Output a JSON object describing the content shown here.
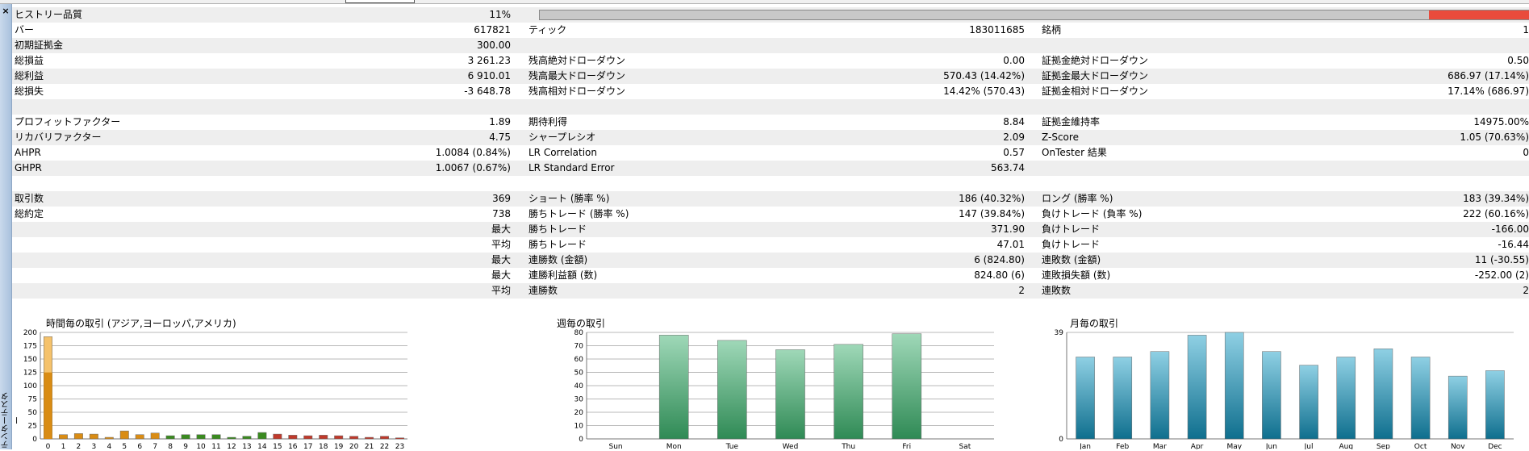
{
  "panel": {
    "close_glyph": "×",
    "vertical_title": "テンターテスター"
  },
  "quality": {
    "label": "ヒストリー品質",
    "value": "11%",
    "fraction": 0.11
  },
  "rows": [
    {
      "alt": true,
      "l1": "ヒストリー品質",
      "v1": "11%",
      "l2": "",
      "v2": "",
      "l3": "",
      "v3": "",
      "bar": true
    },
    {
      "alt": false,
      "l1": "バー",
      "v1": "617821",
      "l2": "ティック",
      "v2": "183011685",
      "l3": "銘柄",
      "v3": "1"
    },
    {
      "alt": true,
      "l1": "初期証拠金",
      "v1": "300.00",
      "l2": "",
      "v2": "",
      "l3": "",
      "v3": ""
    },
    {
      "alt": false,
      "l1": "総損益",
      "v1": "3 261.23",
      "l2": "残高絶対ドローダウン",
      "v2": "0.00",
      "l3": "証拠金絶対ドローダウン",
      "v3": "0.50"
    },
    {
      "alt": true,
      "l1": "総利益",
      "v1": "6 910.01",
      "l2": "残高最大ドローダウン",
      "v2": "570.43 (14.42%)",
      "l3": "証拠金最大ドローダウン",
      "v3": "686.97 (17.14%)"
    },
    {
      "alt": false,
      "l1": "総損失",
      "v1": "-3 648.78",
      "l2": "残高相対ドローダウン",
      "v2": "14.42% (570.43)",
      "l3": "証拠金相対ドローダウン",
      "v3": "17.14% (686.97)"
    },
    {
      "alt": true,
      "l1": "",
      "v1": "",
      "l2": "",
      "v2": "",
      "l3": "",
      "v3": ""
    },
    {
      "alt": false,
      "l1": "プロフィットファクター",
      "v1": "1.89",
      "l2": "期待利得",
      "v2": "8.84",
      "l3": "証拠金維持率",
      "v3": "14975.00%"
    },
    {
      "alt": true,
      "l1": "リカバリファクター",
      "v1": "4.75",
      "l2": "シャープレシオ",
      "v2": "2.09",
      "l3": "Z-Score",
      "v3": "1.05 (70.63%)"
    },
    {
      "alt": false,
      "l1": "AHPR",
      "v1": "1.0084 (0.84%)",
      "l2": "LR Correlation",
      "v2": "0.57",
      "l3": "OnTester 結果",
      "v3": "0"
    },
    {
      "alt": true,
      "l1": "GHPR",
      "v1": "1.0067 (0.67%)",
      "l2": "LR Standard Error",
      "v2": "563.74",
      "l3": "",
      "v3": ""
    },
    {
      "alt": false,
      "l1": "",
      "v1": "",
      "l2": "",
      "v2": "",
      "l3": "",
      "v3": ""
    },
    {
      "alt": true,
      "l1": "取引数",
      "v1": "369",
      "l2": "ショート (勝率 %)",
      "v2": "186 (40.32%)",
      "l3": "ロング (勝率 %)",
      "v3": "183 (39.34%)"
    },
    {
      "alt": false,
      "l1": "総約定",
      "v1": "738",
      "l2": "勝ちトレード (勝率 %)",
      "v2": "147 (39.84%)",
      "l3": "負けトレード (負率 %)",
      "v3": "222 (60.16%)"
    },
    {
      "alt": true,
      "l1": "",
      "v1": "最大",
      "l2": "勝ちトレード",
      "v2": "371.90",
      "l3": "負けトレード",
      "v3": "-166.00"
    },
    {
      "alt": false,
      "l1": "",
      "v1": "平均",
      "l2": "勝ちトレード",
      "v2": "47.01",
      "l3": "負けトレード",
      "v3": "-16.44"
    },
    {
      "alt": true,
      "l1": "",
      "v1": "最大",
      "l2": "連勝数 (金額)",
      "v2": "6 (824.80)",
      "l3": "連敗数 (金額)",
      "v3": "11 (-30.55)"
    },
    {
      "alt": false,
      "l1": "",
      "v1": "最大",
      "l2": "連勝利益額 (数)",
      "v2": "824.80 (6)",
      "l3": "連敗損失額 (数)",
      "v3": "-252.00 (2)"
    },
    {
      "alt": true,
      "l1": "",
      "v1": "平均",
      "l2": "連勝数",
      "v2": "2",
      "l3": "連敗数",
      "v3": "2"
    }
  ],
  "chart_data": [
    {
      "type": "bar",
      "title": "時間毎の取引 (アジア,ヨーロッパ,アメリカ)",
      "categories": [
        "0",
        "1",
        "2",
        "3",
        "4",
        "5",
        "6",
        "7",
        "8",
        "9",
        "10",
        "11",
        "12",
        "13",
        "14",
        "15",
        "16",
        "17",
        "18",
        "19",
        "20",
        "21",
        "22",
        "23"
      ],
      "values": [
        192,
        8,
        10,
        9,
        3,
        15,
        8,
        11,
        6,
        8,
        8,
        8,
        3,
        5,
        12,
        9,
        7,
        6,
        7,
        6,
        5,
        3,
        5,
        2
      ],
      "ylim": [
        0,
        200
      ],
      "yticks": [
        "0",
        "25",
        "50",
        "75",
        "100",
        "125",
        "150",
        "175",
        "200"
      ],
      "colors": [
        "#d98c14",
        "#d98c14",
        "#d98c14",
        "#d98c14",
        "#d98c14",
        "#d98c14",
        "#d98c14",
        "#d98c14",
        "#3a8a1f",
        "#3a8a1f",
        "#3a8a1f",
        "#3a8a1f",
        "#3a8a1f",
        "#3a8a1f",
        "#3a8a1f",
        "#c0392b",
        "#c0392b",
        "#c0392b",
        "#c0392b",
        "#c0392b",
        "#c0392b",
        "#c0392b",
        "#c0392b",
        "#c0392b"
      ],
      "highlight_color": "#f5c26b",
      "grid": true
    },
    {
      "type": "bar",
      "title": "週毎の取引",
      "categories": [
        "Sun",
        "Mon",
        "Tue",
        "Wed",
        "Thu",
        "Fri",
        "Sat"
      ],
      "values": [
        0,
        78,
        74,
        67,
        71,
        79,
        0
      ],
      "ylim": [
        0,
        80
      ],
      "yticks": [
        "0",
        "10",
        "20",
        "30",
        "40",
        "50",
        "60",
        "70",
        "80"
      ],
      "color_top": "#9fd8b8",
      "color_bottom": "#2f8a55",
      "grid": true
    },
    {
      "type": "bar",
      "title": "月毎の取引",
      "categories": [
        "Jan",
        "Feb",
        "Mar",
        "Apr",
        "May",
        "Jun",
        "Jul",
        "Aug",
        "Sep",
        "Oct",
        "Nov",
        "Dec"
      ],
      "values": [
        30,
        30,
        32,
        38,
        39,
        32,
        27,
        30,
        33,
        30,
        23,
        25
      ],
      "ylim": [
        0,
        39
      ],
      "yticks": [
        "0",
        "39"
      ],
      "color_top": "#8fd0e4",
      "color_bottom": "#0f6f8e",
      "grid": true
    }
  ]
}
